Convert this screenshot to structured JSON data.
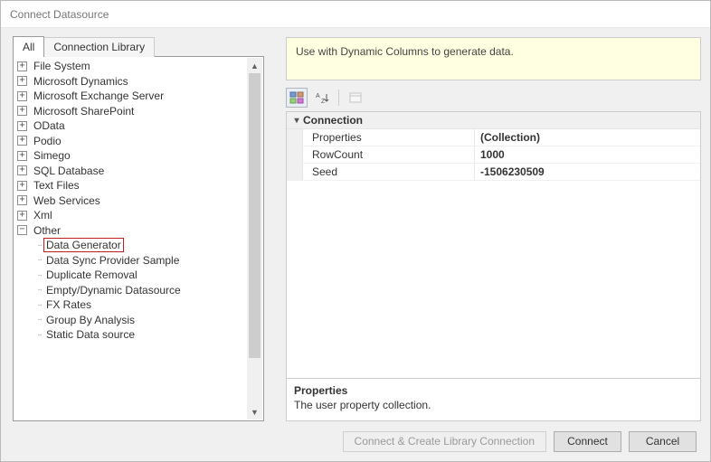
{
  "window": {
    "title": "Connect Datasource"
  },
  "tabs": {
    "all": "All",
    "library": "Connection Library"
  },
  "tree": {
    "top_nodes": [
      "File System",
      "Microsoft Dynamics",
      "Microsoft Exchange Server",
      "Microsoft SharePoint",
      "OData",
      "Podio",
      "Simego",
      "SQL Database",
      "Text Files",
      "Web Services",
      "Xml"
    ],
    "other_label": "Other",
    "other_children": [
      "Data Generator",
      "Data Sync Provider Sample",
      "Duplicate Removal",
      "Empty/Dynamic Datasource",
      "FX Rates",
      "Group By Analysis",
      "Static Data source"
    ]
  },
  "info": {
    "text": "Use with Dynamic Columns to generate data."
  },
  "propgrid": {
    "category": "Connection",
    "rows": [
      {
        "name": "Properties",
        "value": "(Collection)"
      },
      {
        "name": "RowCount",
        "value": "1000"
      },
      {
        "name": "Seed",
        "value": "-1506230509"
      }
    ]
  },
  "description": {
    "title": "Properties",
    "body": "The user property collection."
  },
  "buttons": {
    "create": "Connect & Create Library Connection",
    "connect": "Connect",
    "cancel": "Cancel"
  }
}
